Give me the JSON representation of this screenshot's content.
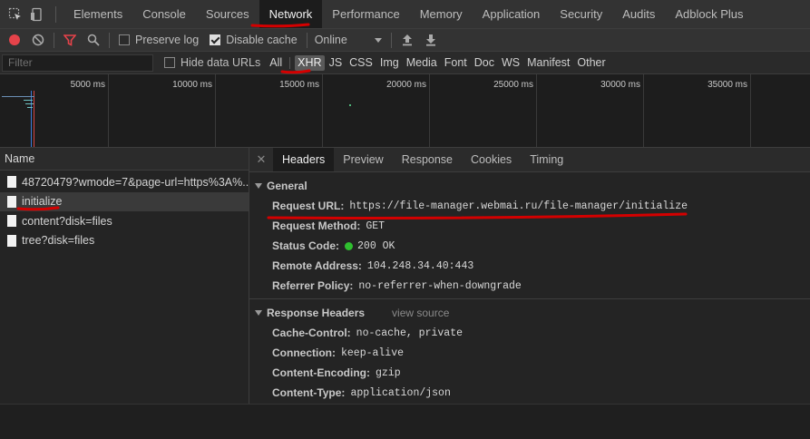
{
  "tabs": [
    "Elements",
    "Console",
    "Sources",
    "Network",
    "Performance",
    "Memory",
    "Application",
    "Security",
    "Audits",
    "Adblock Plus"
  ],
  "active_tab": "Network",
  "toolbar": {
    "preserve_log": "Preserve log",
    "disable_cache": "Disable cache",
    "throttle": "Online",
    "preserve_log_checked": false,
    "disable_cache_checked": true
  },
  "filter": {
    "placeholder": "Filter",
    "hide_data_urls": "Hide data URLs",
    "types": [
      "All",
      "XHR",
      "JS",
      "CSS",
      "Img",
      "Media",
      "Font",
      "Doc",
      "WS",
      "Manifest",
      "Other"
    ],
    "active_type": "XHR"
  },
  "timeline": {
    "labels": [
      "5000 ms",
      "10000 ms",
      "15000 ms",
      "20000 ms",
      "25000 ms",
      "30000 ms",
      "35000 ms"
    ]
  },
  "requests": {
    "header": "Name",
    "items": [
      "48720479?wmode=7&page-url=https%3A%...",
      "initialize",
      "content?disk=files",
      "tree?disk=files"
    ],
    "selected": "initialize"
  },
  "details": {
    "tabs": [
      "Headers",
      "Preview",
      "Response",
      "Cookies",
      "Timing"
    ],
    "active_tab": "Headers",
    "general": {
      "title": "General",
      "request_url_label": "Request URL:",
      "request_url": "https://file-manager.webmai.ru/file-manager/initialize",
      "request_method_label": "Request Method:",
      "request_method": "GET",
      "status_code_label": "Status Code:",
      "status_code": "200 OK",
      "remote_address_label": "Remote Address:",
      "remote_address": "104.248.34.40:443",
      "referrer_policy_label": "Referrer Policy:",
      "referrer_policy": "no-referrer-when-downgrade"
    },
    "response_headers": {
      "title": "Response Headers",
      "view_source": "view source",
      "cache_control_label": "Cache-Control:",
      "cache_control": "no-cache, private",
      "connection_label": "Connection:",
      "connection": "keep-alive",
      "content_encoding_label": "Content-Encoding:",
      "content_encoding": "gzip",
      "content_type_label": "Content-Type:",
      "content_type": "application/json"
    }
  },
  "colors": {
    "annotation": "#d40000",
    "record": "#e6434a",
    "status_ok": "#2fbf2f",
    "filter_icon": "#e6434a"
  }
}
